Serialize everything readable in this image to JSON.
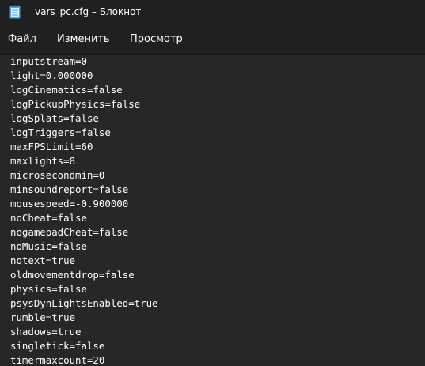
{
  "window": {
    "title": "vars_pc.cfg – Блокнот"
  },
  "menu": {
    "file": "Файл",
    "edit": "Изменить",
    "view": "Просмотр"
  },
  "editor": {
    "lines": [
      "inputstream=0",
      "light=0.000000",
      "logCinematics=false",
      "logPickupPhysics=false",
      "logSplats=false",
      "logTriggers=false",
      "maxFPSLimit=60",
      "maxlights=8",
      "microsecondmin=0",
      "minsoundreport=false",
      "mousespeed=-0.900000",
      "noCheat=false",
      "nogamepadCheat=false",
      "noMusic=false",
      "notext=true",
      "oldmovementdrop=false",
      "physics=false",
      "psysDynLightsEnabled=true",
      "rumble=true",
      "shadows=true",
      "singletick=false",
      "timermaxcount=20"
    ]
  },
  "icons": {
    "app": "notepad-icon"
  },
  "colors": {
    "background": "#272727",
    "chrome": "#202020",
    "text": "#ffffff",
    "icon_accent": "#4aa3e8"
  }
}
